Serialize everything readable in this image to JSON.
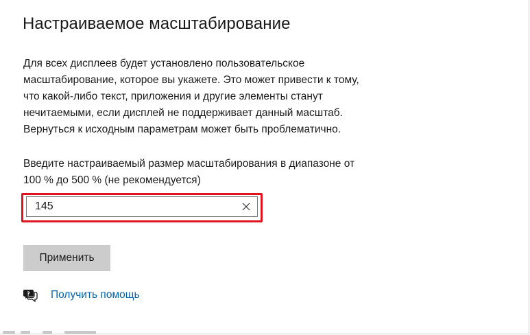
{
  "dialog": {
    "title": "Настраиваемое масштабирование",
    "description_lines": [
      "Для всех дисплеев будет установлено пользовательское",
      "масштабирование, которое вы укажете. Это может привести к тому,",
      "что какой-либо текст, приложения и другие элементы станут",
      "нечитаемыми, если дисплей не поддерживает данный масштаб.",
      "Вернуться к исходным параметрам может быть проблематично."
    ],
    "prompt_lines": [
      "Введите настраиваемый размер масштабирования в диапазоне от",
      "100 % до 500 % (не рекомендуется)"
    ]
  },
  "scale_input": {
    "value": "145"
  },
  "apply_button": {
    "label": "Применить"
  },
  "help": {
    "icon": "chat-help-icon",
    "link_label": "Получить помощь"
  },
  "colors": {
    "highlight": "#e0141e",
    "link": "#0063b1",
    "button_bg": "#cccccc"
  }
}
